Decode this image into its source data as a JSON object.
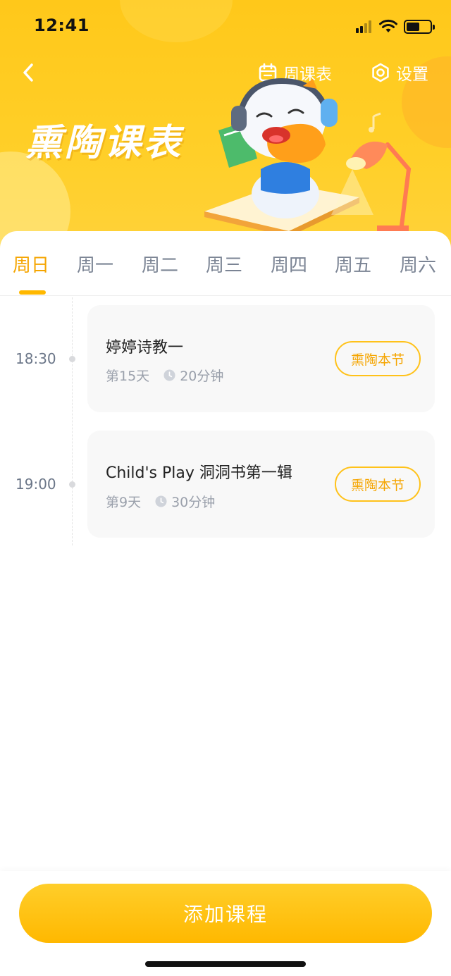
{
  "status_bar": {
    "time": "12:41",
    "battery_level": 0.55
  },
  "header": {
    "banner_title": "熏陶课表",
    "week_schedule_label": "周课表",
    "settings_label": "设置",
    "icons": {
      "back": "chevron-left-icon",
      "week": "calendar-icon",
      "settings": "gear-icon"
    }
  },
  "tabs": [
    {
      "label": "周日",
      "active": true
    },
    {
      "label": "周一",
      "active": false
    },
    {
      "label": "周二",
      "active": false
    },
    {
      "label": "周三",
      "active": false
    },
    {
      "label": "周四",
      "active": false
    },
    {
      "label": "周五",
      "active": false
    },
    {
      "label": "周六",
      "active": false
    }
  ],
  "courses": [
    {
      "time": "18:30",
      "title": "婷婷诗教一",
      "day": "第15天",
      "duration": "20分钟",
      "button": "熏陶本节"
    },
    {
      "time": "19:00",
      "title": "Child's Play 洞洞书第一辑",
      "day": "第9天",
      "duration": "30分钟",
      "button": "熏陶本节"
    }
  ],
  "footer": {
    "add_button": "添加课程"
  },
  "colors": {
    "accent": "#ffb800",
    "accent_text": "#f5a500",
    "header_bg": "#ffc81a"
  }
}
